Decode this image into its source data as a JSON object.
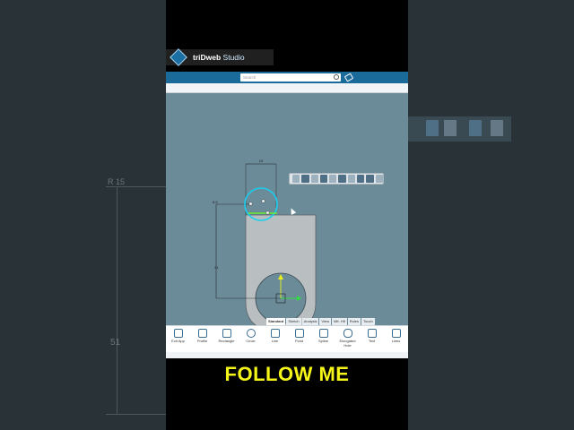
{
  "brand": {
    "name_bold": "triDweb",
    "name_light": " Studio"
  },
  "search": {
    "placeholder": "Search"
  },
  "tabs": [
    "Standard",
    "Sketch",
    "Analysis",
    "View",
    "Mfr. Hlf",
    "Rules",
    "Touch"
  ],
  "active_tab": "Standard",
  "ribbon": [
    {
      "label": "Exit App",
      "icon": "exit-icon"
    },
    {
      "label": "Profile",
      "icon": "profile-icon"
    },
    {
      "label": "Rectangle",
      "icon": "rectangle-icon"
    },
    {
      "label": "Circle",
      "icon": "circle-icon"
    },
    {
      "label": "Line",
      "icon": "line-icon"
    },
    {
      "label": "Point",
      "icon": "point-icon"
    },
    {
      "label": "Spline",
      "icon": "spline-icon"
    },
    {
      "label": "Elongated Hole",
      "icon": "slot-icon"
    },
    {
      "label": "Text",
      "icon": "text-icon"
    },
    {
      "label": "Lines",
      "icon": "lines-icon"
    }
  ],
  "dimensions": {
    "width_top": "10",
    "height_left": "31",
    "radius_left": "R 15",
    "value_51": "51"
  },
  "caption": "FOLLOW ME",
  "colors": {
    "accent": "#1a6a9a",
    "canvas": "#6b8b99",
    "caption": "#f5f51a",
    "selection": "#18d0f0"
  }
}
